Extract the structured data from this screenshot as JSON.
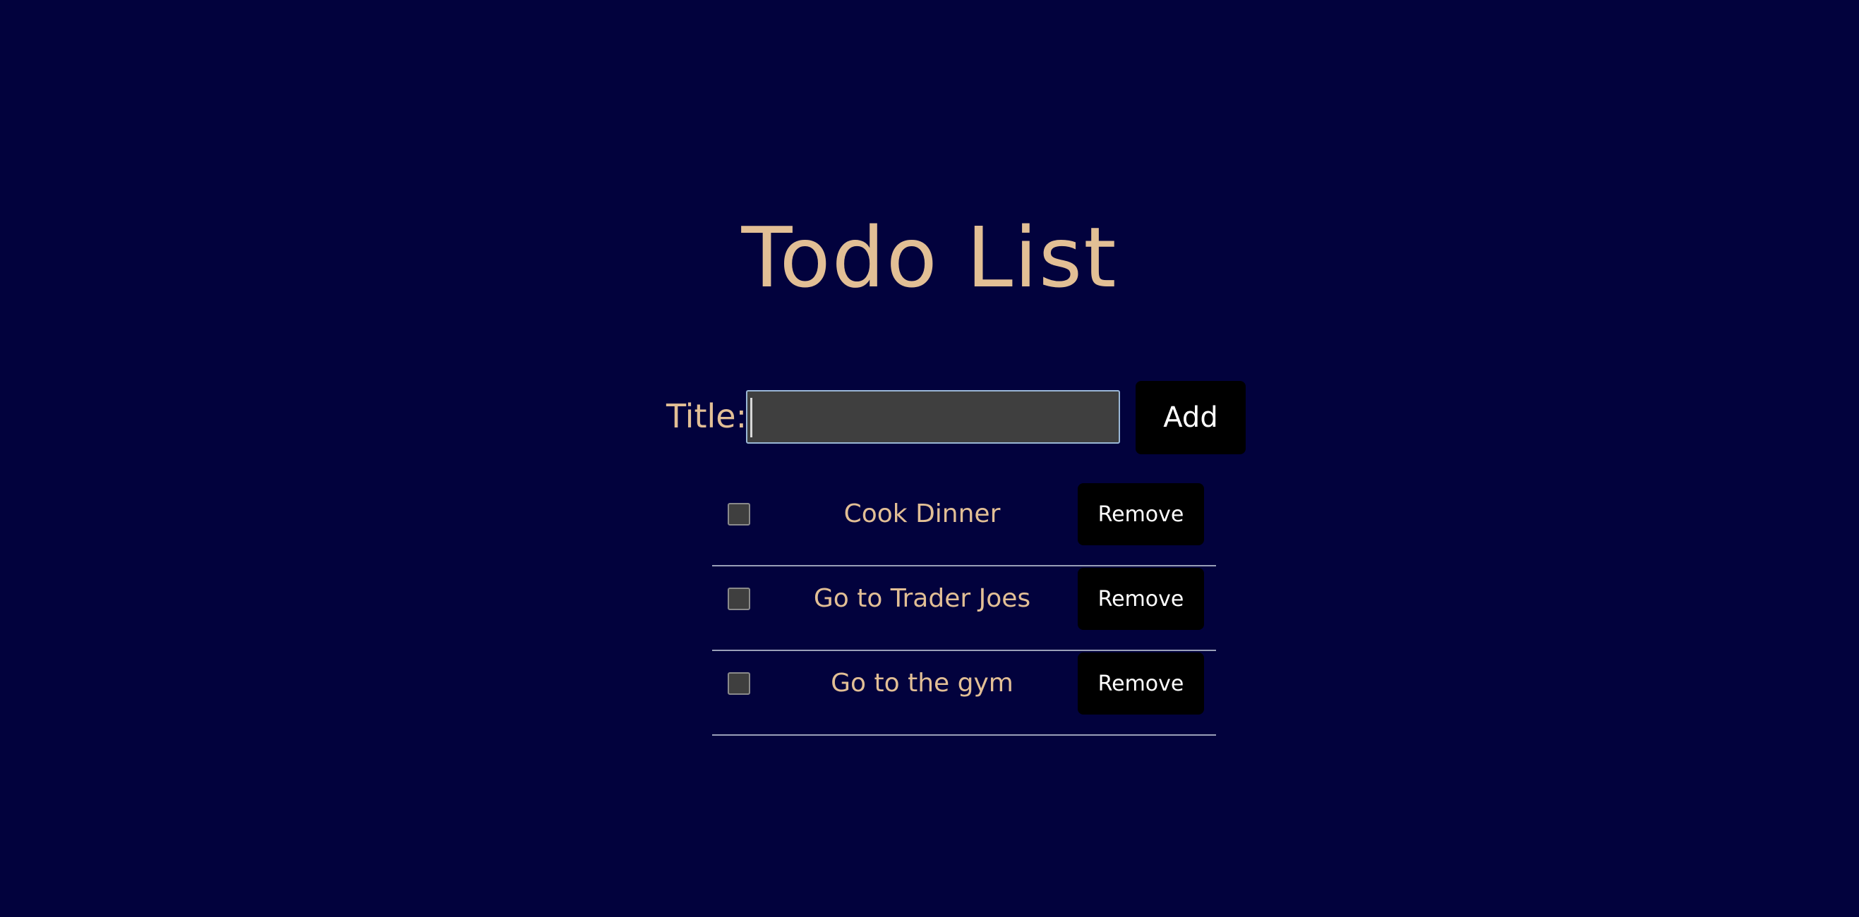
{
  "app": {
    "title": "Todo List"
  },
  "form": {
    "label": "Title:",
    "input_value": "",
    "input_placeholder": "",
    "add_label": "Add"
  },
  "todos": [
    {
      "label": "Cook Dinner",
      "checked": false,
      "remove_label": "Remove"
    },
    {
      "label": "Go to Trader Joes",
      "checked": false,
      "remove_label": "Remove"
    },
    {
      "label": "Go to the gym",
      "checked": false,
      "remove_label": "Remove"
    }
  ],
  "colors": {
    "background": "#02023d",
    "accent_text": "#e2bf95",
    "button_bg": "#000000",
    "button_text": "#ffffff",
    "input_bg": "#3f3f3f",
    "input_border": "#9ab7d6"
  }
}
